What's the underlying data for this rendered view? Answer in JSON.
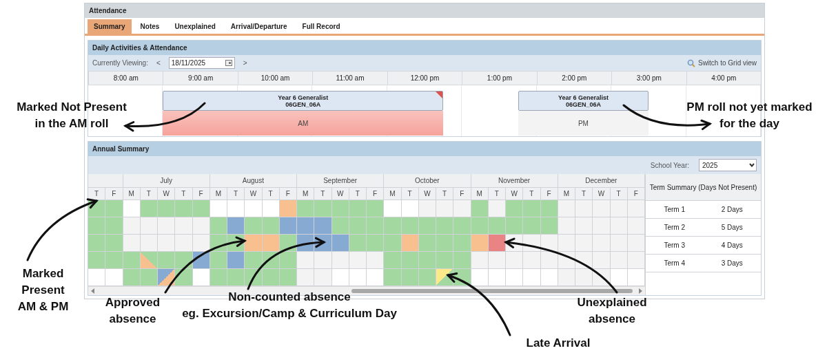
{
  "panel": {
    "title": "Attendance"
  },
  "tabs": [
    {
      "label": "Summary",
      "selected": true
    },
    {
      "label": "Notes",
      "selected": false
    },
    {
      "label": "Unexplained",
      "selected": false
    },
    {
      "label": "Arrival/Departure",
      "selected": false
    },
    {
      "label": "Full Record",
      "selected": false
    }
  ],
  "daily": {
    "title": "Daily Activities & Attendance",
    "viewing_label": "Currently Viewing:",
    "prev": "<",
    "date": "18/11/2025",
    "next": ">",
    "grid_link": "Switch to Grid view",
    "hours": [
      "8:00 am",
      "9:00 am",
      "10:00 am",
      "11:00 am",
      "12:00 pm",
      "1:00 pm",
      "2:00 pm",
      "3:00 pm",
      "4:00 pm"
    ],
    "events": [
      {
        "title": "Year 6 Generalist",
        "code": "06GEN_06A",
        "roll": "AM",
        "marked": true,
        "present": false,
        "flagged": true
      },
      {
        "title": "Year 6 Generalist",
        "code": "06GEN_06A",
        "roll": "PM",
        "marked": false,
        "flagged": false
      }
    ]
  },
  "annual": {
    "title": "Annual Summary",
    "year_label": "School Year:",
    "year": "2025",
    "months": [
      {
        "days": [
          "T",
          "F"
        ]
      },
      {
        "name": "July",
        "days": [
          "M",
          "T",
          "W",
          "T",
          "F"
        ]
      },
      {
        "name": "August",
        "days": [
          "M",
          "T",
          "W",
          "T",
          "F"
        ]
      },
      {
        "name": "September",
        "days": [
          "M",
          "T",
          "W",
          "T",
          "F"
        ]
      },
      {
        "name": "October",
        "days": [
          "M",
          "T",
          "W",
          "T",
          "F"
        ]
      },
      {
        "name": "November",
        "days": [
          "M",
          "T",
          "W",
          "T",
          "F"
        ]
      },
      {
        "name": "December",
        "days": [
          "M",
          "T",
          "W",
          "T",
          "F"
        ]
      }
    ],
    "weeks": [
      {
        "days": [
          {
            "kind": "present"
          },
          {
            "kind": "present"
          },
          {
            "kind": "blank"
          },
          {
            "kind": "present"
          },
          {
            "kind": "present"
          },
          {
            "kind": "present"
          },
          {
            "kind": "present"
          },
          {
            "kind": "blank"
          },
          {
            "kind": "blank"
          },
          {
            "kind": "blank"
          },
          {
            "kind": "blank"
          },
          {
            "kind": "approved"
          },
          {
            "kind": "present"
          },
          {
            "kind": "present"
          },
          {
            "kind": "present"
          },
          {
            "kind": "present"
          },
          {
            "kind": "present"
          },
          {
            "kind": "blank"
          },
          {
            "kind": "blank"
          },
          {
            "kind": "closed"
          },
          {
            "kind": "closed"
          },
          {
            "kind": "closed"
          },
          {
            "kind": "present"
          },
          {
            "kind": "closed"
          },
          {
            "kind": "present"
          },
          {
            "kind": "present"
          },
          {
            "kind": "present"
          },
          {
            "kind": "closed"
          },
          {
            "kind": "closed"
          },
          {
            "kind": "closed"
          },
          {
            "kind": "closed"
          },
          {
            "kind": "closed"
          }
        ]
      },
      {
        "days": [
          {
            "kind": "present"
          },
          {
            "kind": "present"
          },
          {
            "kind": "closed"
          },
          {
            "kind": "closed"
          },
          {
            "kind": "closed"
          },
          {
            "kind": "closed"
          },
          {
            "kind": "closed"
          },
          {
            "kind": "present"
          },
          {
            "kind": "noncounted"
          },
          {
            "kind": "present"
          },
          {
            "kind": "present"
          },
          {
            "kind": "noncounted"
          },
          {
            "kind": "noncounted"
          },
          {
            "kind": "noncounted"
          },
          {
            "kind": "present"
          },
          {
            "kind": "present"
          },
          {
            "kind": "present"
          },
          {
            "kind": "present"
          },
          {
            "kind": "present"
          },
          {
            "kind": "present"
          },
          {
            "kind": "present"
          },
          {
            "kind": "present"
          },
          {
            "kind": "present"
          },
          {
            "kind": "present"
          },
          {
            "kind": "present"
          },
          {
            "kind": "present"
          },
          {
            "kind": "present"
          },
          {
            "kind": "closed"
          },
          {
            "kind": "closed"
          },
          {
            "kind": "closed"
          },
          {
            "kind": "closed"
          },
          {
            "kind": "closed"
          }
        ]
      },
      {
        "days": [
          {
            "kind": "present"
          },
          {
            "kind": "present"
          },
          {
            "kind": "closed"
          },
          {
            "kind": "closed"
          },
          {
            "kind": "closed"
          },
          {
            "kind": "closed"
          },
          {
            "kind": "closed"
          },
          {
            "kind": "present"
          },
          {
            "kind": "present"
          },
          {
            "kind": "approved"
          },
          {
            "kind": "approved"
          },
          {
            "kind": "present"
          },
          {
            "kind": "noncounted"
          },
          {
            "kind": "noncounted"
          },
          {
            "kind": "noncounted"
          },
          {
            "kind": "present"
          },
          {
            "kind": "present"
          },
          {
            "kind": "present"
          },
          {
            "kind": "approved"
          },
          {
            "kind": "present"
          },
          {
            "kind": "present"
          },
          {
            "kind": "present"
          },
          {
            "kind": "approved"
          },
          {
            "kind": "unexplained"
          },
          {
            "kind": "closed"
          },
          {
            "kind": "closed"
          },
          {
            "kind": "closed"
          },
          {
            "kind": "closed"
          },
          {
            "kind": "closed"
          },
          {
            "kind": "closed"
          },
          {
            "kind": "closed"
          },
          {
            "kind": "closed"
          }
        ]
      },
      {
        "days": [
          {
            "kind": "present"
          },
          {
            "kind": "present"
          },
          {
            "kind": "present"
          },
          {
            "kind": "halfapproved"
          },
          {
            "kind": "present"
          },
          {
            "kind": "present"
          },
          {
            "kind": "noncounted"
          },
          {
            "kind": "present"
          },
          {
            "kind": "noncounted"
          },
          {
            "kind": "present"
          },
          {
            "kind": "present"
          },
          {
            "kind": "present"
          },
          {
            "kind": "closed"
          },
          {
            "kind": "closed"
          },
          {
            "kind": "closed"
          },
          {
            "kind": "closed"
          },
          {
            "kind": "closed"
          },
          {
            "kind": "present"
          },
          {
            "kind": "present"
          },
          {
            "kind": "present"
          },
          {
            "kind": "present"
          },
          {
            "kind": "present"
          },
          {
            "kind": "closed"
          },
          {
            "kind": "closed"
          },
          {
            "kind": "closed"
          },
          {
            "kind": "closed"
          },
          {
            "kind": "closed"
          },
          {
            "kind": "closed"
          },
          {
            "kind": "closed"
          },
          {
            "kind": "closed"
          },
          {
            "kind": "closed"
          },
          {
            "kind": "closed"
          }
        ]
      },
      {
        "days": [
          {
            "kind": "blank"
          },
          {
            "kind": "blank"
          },
          {
            "kind": "present"
          },
          {
            "kind": "present"
          },
          {
            "kind": "split"
          },
          {
            "kind": "present"
          },
          {
            "kind": "blank"
          },
          {
            "kind": "present"
          },
          {
            "kind": "present"
          },
          {
            "kind": "present"
          },
          {
            "kind": "present"
          },
          {
            "kind": "present"
          },
          {
            "kind": "closed"
          },
          {
            "kind": "closed"
          },
          {
            "kind": "blank"
          },
          {
            "kind": "blank"
          },
          {
            "kind": "blank"
          },
          {
            "kind": "present"
          },
          {
            "kind": "present"
          },
          {
            "kind": "present"
          },
          {
            "kind": "late"
          },
          {
            "kind": "present"
          },
          {
            "kind": "blank"
          },
          {
            "kind": "blank"
          },
          {
            "kind": "blank"
          },
          {
            "kind": "blank"
          },
          {
            "kind": "blank"
          },
          {
            "kind": "closed"
          },
          {
            "kind": "closed"
          },
          {
            "kind": "closed"
          },
          {
            "kind": "blank"
          },
          {
            "kind": "blank"
          }
        ]
      }
    ],
    "term_summary": {
      "title": "Term Summary (Days Not Present)",
      "rows": [
        {
          "term": "Term 1",
          "days": "2 Days"
        },
        {
          "term": "Term 2",
          "days": "5 Days"
        },
        {
          "term": "Term 3",
          "days": "4 Days"
        },
        {
          "term": "Term 4",
          "days": "3 Days"
        }
      ]
    }
  },
  "annotations": [
    {
      "lines": [
        "Marked Not Present",
        "in the AM roll"
      ]
    },
    {
      "lines": [
        "PM roll not yet marked",
        "for the day"
      ]
    },
    {
      "lines": [
        "Marked Present",
        "AM & PM"
      ]
    },
    {
      "lines": [
        "Approved",
        "absence"
      ]
    },
    {
      "lines": [
        "Non-counted absence",
        "eg. Excursion/Camp & Curriculum Day"
      ]
    },
    {
      "lines": [
        "Late Arrival"
      ]
    },
    {
      "lines": [
        "Unexplained",
        "absence"
      ]
    }
  ]
}
